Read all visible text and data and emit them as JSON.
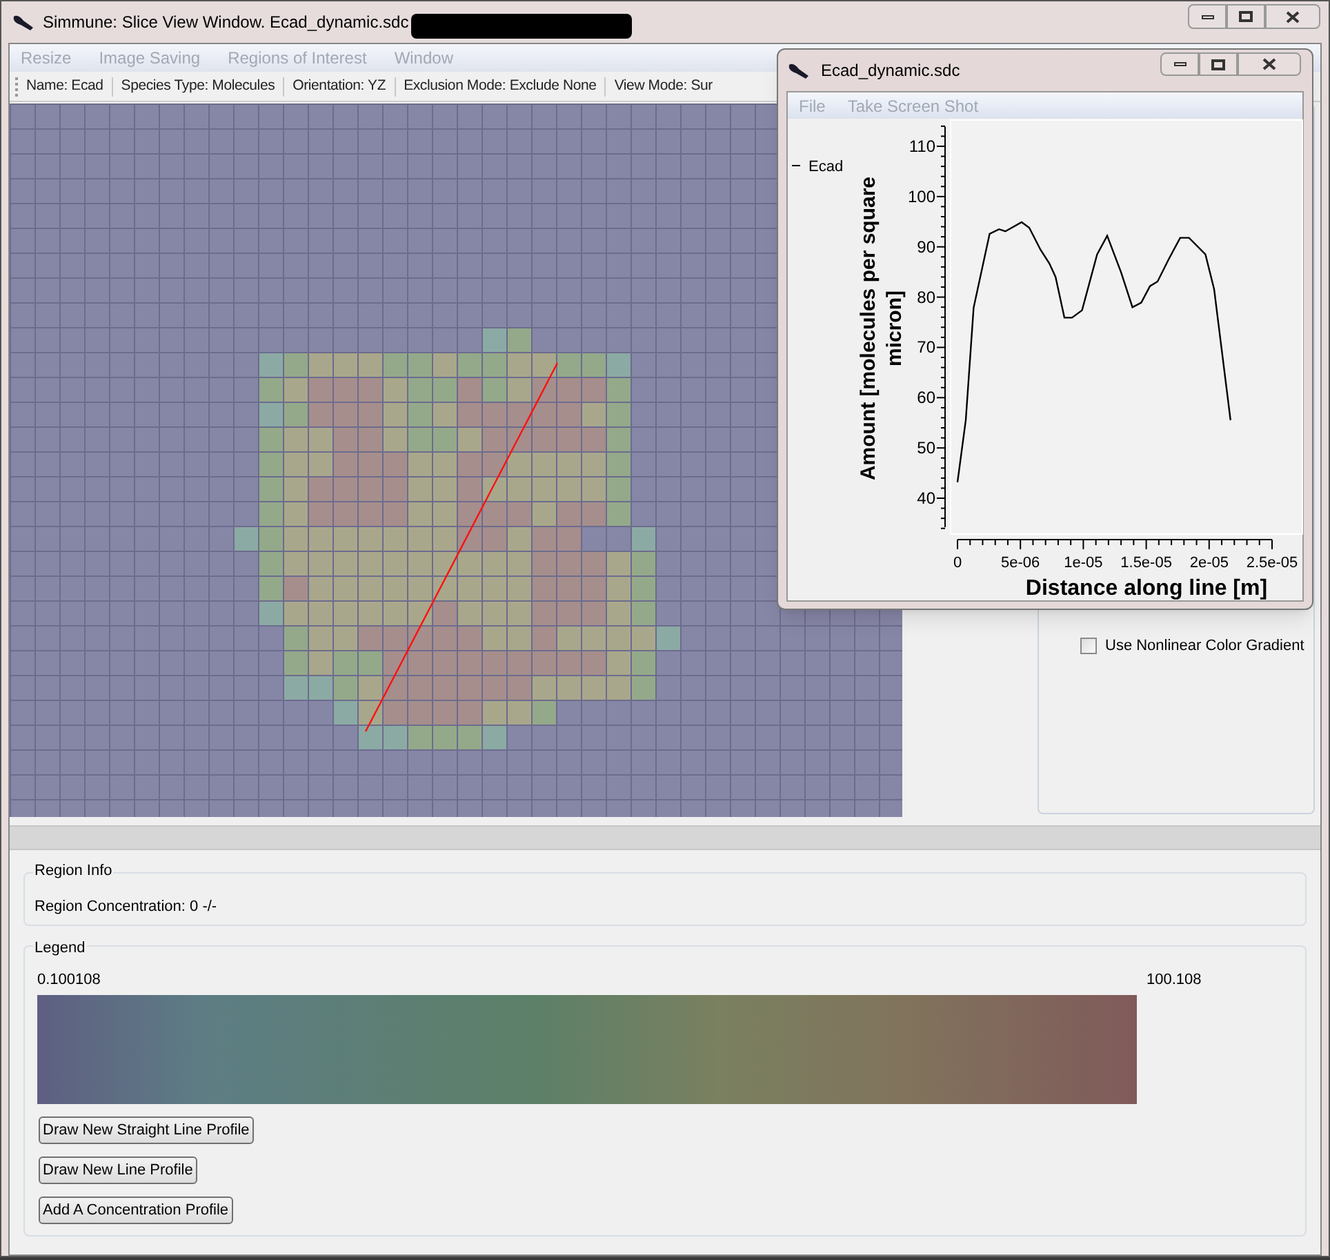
{
  "main_window": {
    "title": "Simmune: Slice View Window. Ecad_dynamic.sdc"
  },
  "menu": [
    {
      "label": "Resize",
      "disabled": true
    },
    {
      "label": "Image Saving",
      "disabled": true
    },
    {
      "label": "Regions of Interest",
      "disabled": true
    },
    {
      "label": "Window",
      "disabled": true
    }
  ],
  "toolbar": [
    "Name: Ecad",
    "Species Type: Molecules",
    "Orientation: YZ",
    "Exclusion Mode: Exclude None",
    "View Mode: Sur"
  ],
  "side_panel": {
    "checkbox": {
      "label": "Use Nonlinear Color Gradient",
      "checked": false
    }
  },
  "region_info": {
    "title": "Region Info",
    "text": "Region Concentration: 0 -/-"
  },
  "legend": {
    "title": "Legend",
    "min": "0.100108",
    "max": "100.108"
  },
  "buttons": [
    "Draw New Straight Line Profile",
    "Draw New Line Profile",
    "Add A Concentration Profile"
  ],
  "plot_window": {
    "title": "Ecad_dynamic.sdc",
    "menu": [
      {
        "label": "File",
        "disabled": true
      },
      {
        "label": "Take Screen Shot",
        "disabled": true
      }
    ],
    "chart_data": {
      "type": "line",
      "xlabel": "Distance along line [m]",
      "ylabel": "Amount [molecules per square micron]",
      "x": [
        0,
        6.6e-07,
        1.28e-06,
        2.55e-06,
        3.3e-06,
        3.8e-06,
        5.1e-06,
        5.7e-06,
        6.6e-06,
        7.3e-06,
        7.8e-06,
        8.5e-06,
        9.1e-06,
        9.9e-06,
        1.11e-05,
        1.19e-05,
        1.3e-05,
        1.39e-05,
        1.46e-05,
        1.53e-05,
        1.59e-05,
        1.68e-05,
        1.77e-05,
        1.84e-05,
        1.97e-05,
        2.04e-05,
        2.17e-05
      ],
      "series": [
        {
          "name": "Ecad",
          "color": "#000000",
          "values": [
            43.2,
            55.5,
            77.9,
            92.6,
            93.5,
            93.1,
            94.9,
            93.8,
            89.4,
            86.7,
            84,
            75.9,
            75.9,
            77.4,
            88.5,
            92.2,
            84.9,
            78,
            78.9,
            82.2,
            83.1,
            87.6,
            91.8,
            91.8,
            88.5,
            81.6,
            55.5
          ]
        }
      ],
      "xlim": [
        0,
        2.5e-05
      ],
      "ylim": [
        33.4,
        115
      ],
      "xticks": [
        {
          "value": 0,
          "label": "0"
        },
        {
          "value": 5e-06,
          "label": "5e-06"
        },
        {
          "value": 1e-05,
          "label": "1e-05"
        },
        {
          "value": 1.5e-05,
          "label": "1.5e-05"
        },
        {
          "value": 2e-05,
          "label": "2e-05"
        },
        {
          "value": 2.5e-05,
          "label": "2.5e-05"
        }
      ],
      "yticks": [
        40,
        50,
        60,
        70,
        80,
        90,
        100,
        110
      ]
    }
  }
}
